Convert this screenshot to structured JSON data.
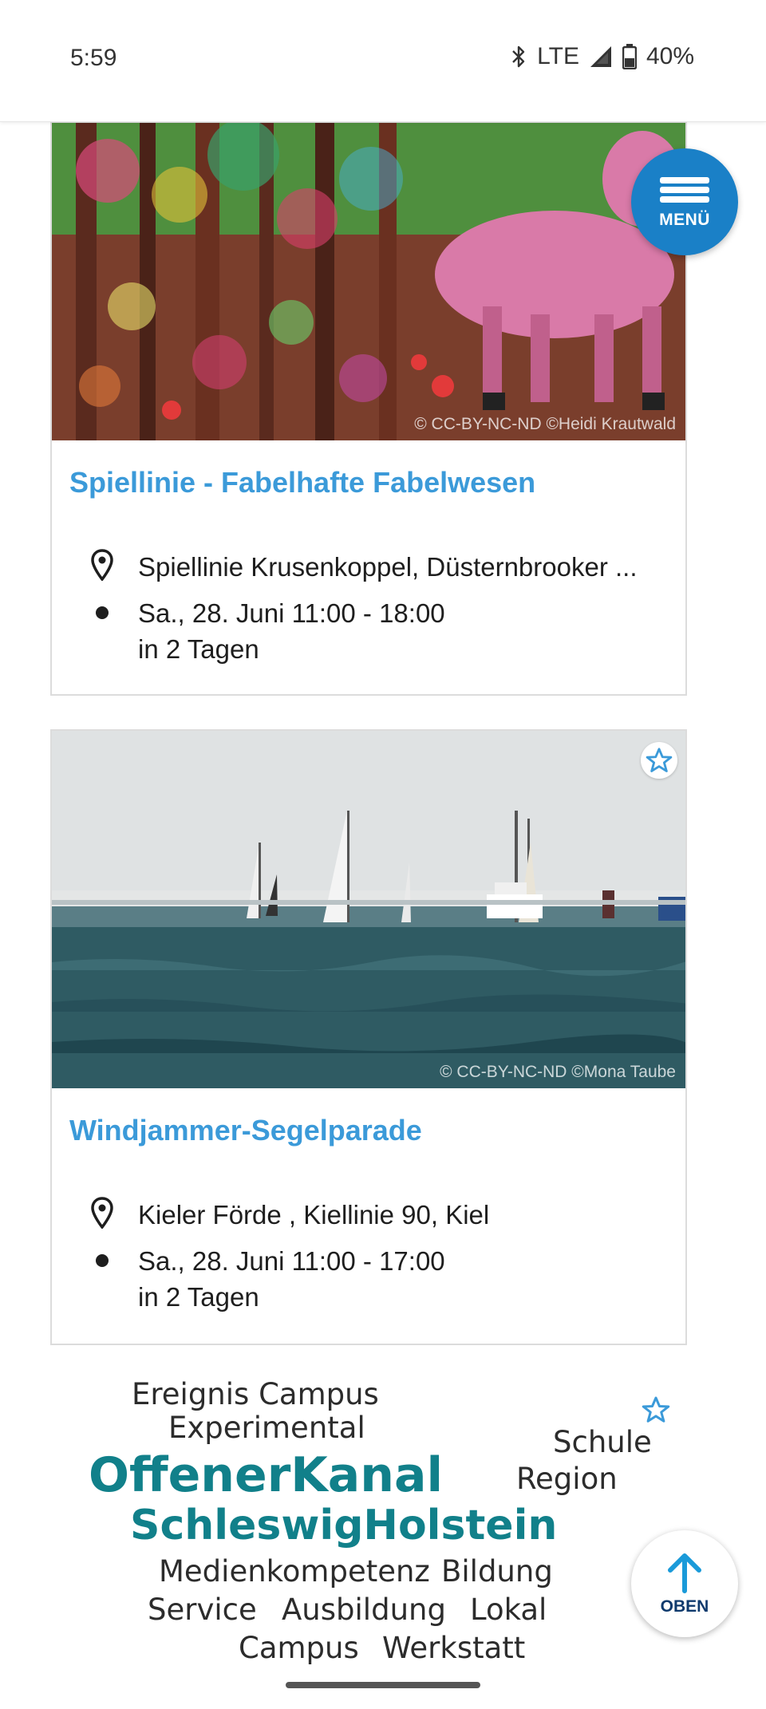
{
  "status_bar": {
    "time": "5:59",
    "network": "LTE",
    "battery": "40%"
  },
  "menu_button": {
    "label": "MENÜ"
  },
  "top_button": {
    "label": "OBEN"
  },
  "events": [
    {
      "title": "Spiellinie - Fabelhafte Fabelwesen",
      "image_credit": "© CC-BY-NC-ND ©Heidi Krautwald",
      "location": "Spiellinie Krusenkoppel, Düsternbrooker ...",
      "date": "Sa., 28. Juni 11:00 - 18:00",
      "relative": "in 2 Tagen"
    },
    {
      "title": "Windjammer-Segelparade",
      "image_credit": "© CC-BY-NC-ND ©Mona Taube",
      "location": "Kieler Förde , Kiellinie 90, Kiel",
      "date": "Sa., 28. Juni 11:00 - 17:00",
      "relative": "in 2 Tagen"
    }
  ],
  "wordcloud": {
    "words": [
      "Ereignis Campus",
      "Experimental",
      "Schule",
      "OffenerKanal",
      "Region",
      "SchleswigHolstein",
      "Medienkompetenz",
      "Bildung",
      "Service",
      "Ausbildung",
      "Lokal",
      "Campus",
      "Werkstatt"
    ]
  },
  "colors": {
    "accent": "#3b9ad9",
    "menu_blue": "#1a80c7",
    "teal": "#11808a"
  }
}
